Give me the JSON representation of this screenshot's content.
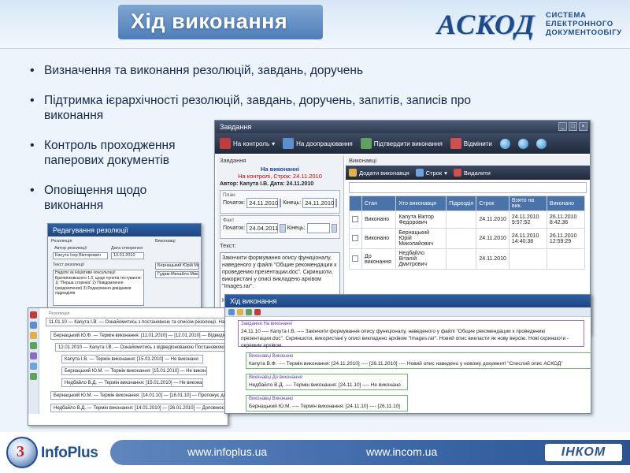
{
  "header": {
    "title": "Хід виконання",
    "logo_name": "АСКОД",
    "logo_subtitle": [
      "СИСТЕМА",
      "ЕЛЕКТРОННОГО",
      "ДОКУМЕНТООБІГУ"
    ]
  },
  "bullets": [
    "Визначення та виконання резолюцій, завдань, доручень",
    "Підтримка ієрархічності резолюцій, завдань, доручень, запитів, записів про",
    "виконання",
    "Контроль проходження",
    "паперових документів",
    "Оповіщення щодо",
    "виконання"
  ],
  "main_window": {
    "title": "Завдання",
    "toolbar": [
      "На контроль",
      "На доопрацювання",
      "Підтвердити виконання",
      "Відмінити"
    ],
    "left": {
      "section": "Завдання",
      "status1": "На виконанні",
      "status2": "На контролі, Строк: 24.11.2010",
      "author": "Автор: Каnута I.B. Дата: 24.11.2010",
      "plan_label": "План",
      "fact_label": "Факт",
      "start_label": "Початок:",
      "end_label": "Кінець:",
      "plan_start": "24.11.2010",
      "plan_end": "24.11.2010",
      "fact_start": "24.04.2011",
      "fact_end": "",
      "text_label": "Текст:",
      "text": "Закінчити формування опису функціоналу, наведеного у файлі \"Общие рекомендации к проведению презентации.doc\". Скриншоти, використані у описі викладено архівом \"Images.rar\".\n\nНовий опис викласти як нову версію. Нові"
    },
    "right": {
      "section": "Виконавці",
      "tools": [
        "Додати виконавця",
        "Строк",
        "Видалити"
      ],
      "columns": [
        "Стан",
        "Хто виконавця",
        "Підрозділ",
        "Строк",
        "Взято на вик.",
        "Виконано"
      ],
      "rows": [
        {
          "state": "Виконано",
          "who": "Каnута Віктор Федорович",
          "dept": "",
          "term": "24.11.2010",
          "taken": "24.11.2010 9:57:52",
          "done": "26.11.2010 8:42:36"
        },
        {
          "state": "Виконано",
          "who": "Бернацький Юрій Миколайович",
          "dept": "",
          "term": "24.11.2010",
          "taken": "24.11.2010 14:40:38",
          "done": "26.11.2010 12:59:29"
        },
        {
          "state": "До виконання",
          "who": "Недбайло Віталій Дмитрович",
          "dept": "",
          "term": "24.11.2010",
          "taken": "",
          "done": ""
        }
      ]
    }
  },
  "resolution_window": {
    "title": "Редагування резолюції",
    "labels": [
      "Резолюція",
      "Автор резолюції",
      "Дата створення",
      "Текст резолюції",
      "Виконавці"
    ],
    "author": "Каnута Ігор Вікторович",
    "date": "13.01.2010",
    "text": "Надати за ініціативи консультації Бритвінковського 1.0, щодо пунктів тестування: 1) \"Перша сторінка\" 2) Повідомлення (уведомления) 3) Редагування довідників підрозділів",
    "executors": [
      "Бернацький Юрій Мико",
      "Гудим-Михайло Мико"
    ]
  },
  "tree_window": {
    "caption": "Резолюція",
    "lines": [
      "11.01.10 — Каnута І.В. — Ознайомитись з постановкою та описом резолюції. На дата",
      "Бернацький Ю.Ф. — Термін виконання: [11.01.2010] — [12.01.2010] — Відведіонована Постановк",
      "12.01.2010 — Каnута І.В. — Ознайомитись з відведіонованою Постановкою 'Постанов",
      "Каnута І.В. — Термін виконання: [15.01.2010] — Не виконано",
      "Бернацький Ю.М. — Термін виконання: [15.01.2010] — Не виконано",
      "Недбайло В.Д. — Термін виконання: [15.01.2010] — Не виконано",
      "Бернацький Ю.М. — Термін виконання: [14.01.10] — [18.01.10] — Пропонує для потреб",
      "Недбайло В.Д. — Термін виконання: [14.01.2010] — [26.01.2010] — Доповнює сли"
    ]
  },
  "progress_window": {
    "title": "Хід виконання",
    "top_caption": "Завдання На виконанні",
    "top_text": "24.11.10 ---- Каnута І.В. ---- Закінчити формування опису функціоналу, наведеного у файлі \"Общие рекомендации к проведению презентации.doc\". Скриншоти, використані у описі викладено архівом \"Images.rar\". Новий опис викласти як нову версію. Нові скриншоти - окремим архівом.",
    "boxes": [
      {
        "caption": "Виконавці Виконано",
        "text": "Каnута В.Ф. ---- Термін виконання: [24.11.2010] ---- [26.11.2010] ---- Новий опис наведено у новому документі \"Спеслий опис АСКОД\""
      },
      {
        "caption": "Виконавці До виконання",
        "text": "Недбайло В.Д. ---- Термін виконання: [24.11.10] ---- Не виконано"
      },
      {
        "caption": "Виконавці Виконано",
        "text": "Бернацький Ю.М. ---- Термін виконання: [24.11.10] ---- [26.11.10]"
      }
    ]
  },
  "footer": {
    "brand": "InfoPlus",
    "url1": "www.infoplus.ua",
    "url2": "www.incom.ua",
    "partner": "ІНКОМ"
  }
}
